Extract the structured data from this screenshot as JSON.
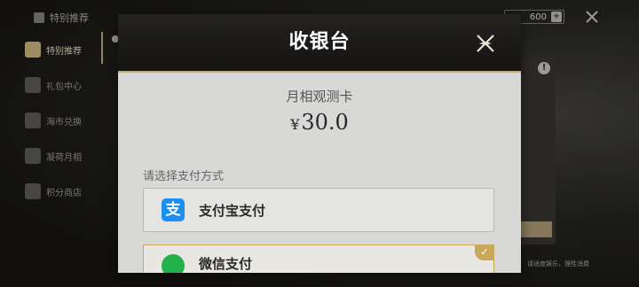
{
  "background": {
    "breadcrumb": "特别推荐",
    "sidebar": [
      {
        "label": "特别推荐",
        "active": true
      },
      {
        "label": "礼包中心"
      },
      {
        "label": "海市兑换"
      },
      {
        "label": "凝荷月相"
      },
      {
        "label": "积分商店"
      }
    ],
    "currency_value": "600",
    "currency_plus": "+",
    "info_mark": "!",
    "bottom_note": "请适度娱乐，理性消费"
  },
  "modal": {
    "title": "收银台",
    "product_name": "月相观测卡",
    "currency_symbol": "¥",
    "price": "30.0",
    "pay_method_label": "请选择支付方式",
    "options": [
      {
        "label": "支付宝支付",
        "icon": "alipay-icon",
        "icon_glyph": "支"
      },
      {
        "label": "微信支付",
        "icon": "wechat-icon",
        "selected": true,
        "check": "✓"
      }
    ]
  },
  "colors": {
    "header_bg": "#1a1917",
    "accent_gold": "#caa85a",
    "alipay_blue": "#1b8ff2",
    "wechat_green": "#23b14b"
  }
}
